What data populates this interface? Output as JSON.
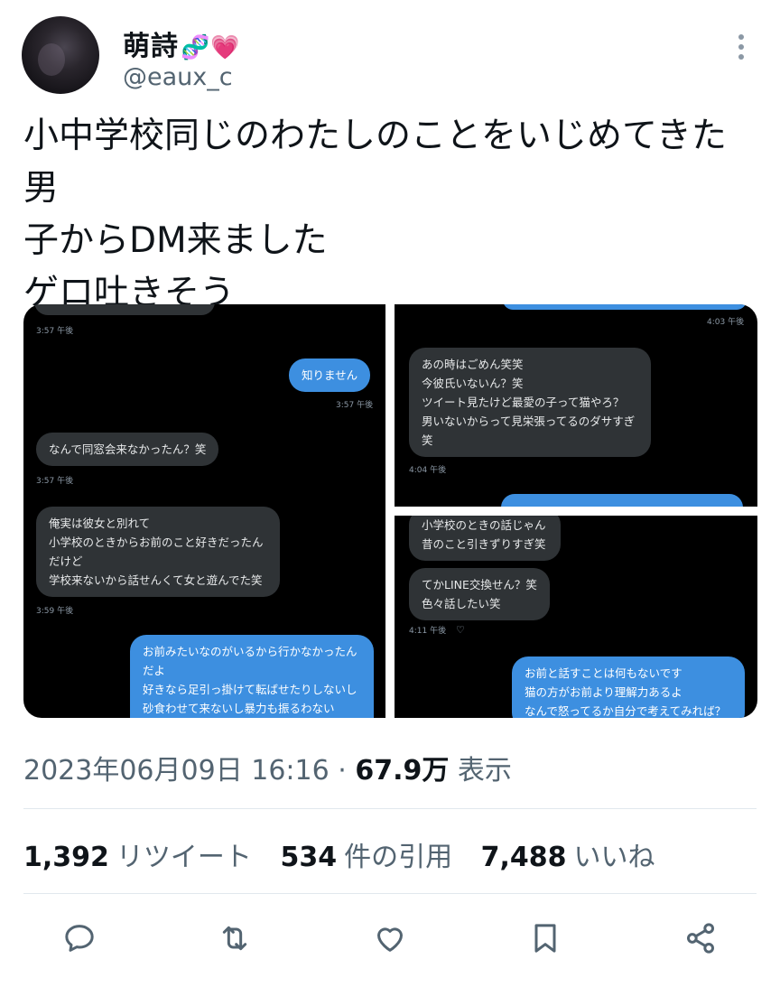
{
  "user": {
    "display_name": "萌詩",
    "emoji": "🧬💗",
    "handle": "@eaux_c"
  },
  "tweet": {
    "lines": [
      "小中学校同じのわたしのことをいじめてきた男",
      "子からDM来ました",
      "ゲロ吐きそう"
    ]
  },
  "screenshots": {
    "left": {
      "ts1": "3:57 午後",
      "out1": "知りません",
      "ts2": "3:57 午後",
      "in1": "なんで同窓会来なかったん？笑",
      "ts3": "3:57 午後",
      "in2": [
        "俺実は彼女と別れて",
        "小学校のときからお前のこと好きだったん",
        "だけど",
        "学校来ないから話せんくて女と遊んでた笑"
      ],
      "ts4": "3:59 午後",
      "out2": [
        "お前みたいなのがいるから行かなかったん",
        "だよ",
        "好きなら足引っ掛けて転ばせたりしないし",
        "砂食わせて来ないし暴力も振るわない"
      ]
    },
    "top_right": {
      "ts1": "4:03 午後",
      "in1": [
        "あの時はごめん笑笑",
        "今彼氏いないん？笑",
        "ツイート見たけど最愛の子って猫やろ？",
        "男いないからって見栄張ってるのダサすぎ",
        "笑"
      ],
      "ts2": "4:04 午後"
    },
    "bottom_right": {
      "in1": [
        "小学校のときの話じゃん",
        "昔のこと引きずりすぎ笑"
      ],
      "in2": [
        "てかLINE交換せん？笑",
        "色々話したい笑"
      ],
      "ts1": "4:11 午後",
      "out1": [
        "お前と話すことは何もないです",
        "猫の方がお前より理解力あるよ",
        "なんで怒ってるか自分で考えてみれば？"
      ]
    }
  },
  "meta": {
    "datetime": "2023年06月09日 16:16",
    "separator": "·",
    "views": "67.9万",
    "views_label": "表示"
  },
  "stats": {
    "retweets": "1,392",
    "retweets_label": "リツイート",
    "quotes": "534",
    "quotes_label": "件の引用",
    "likes": "7,488",
    "likes_label": "いいね"
  },
  "actions": {
    "reply_icon": "reply-icon",
    "retweet_icon": "retweet-icon",
    "like_icon": "heart-icon",
    "bookmark_icon": "bookmark-icon",
    "share_icon": "share-icon"
  }
}
